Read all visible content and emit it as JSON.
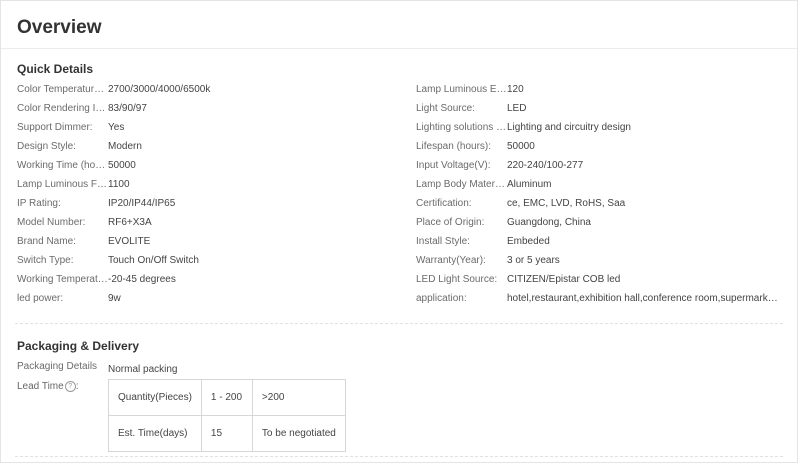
{
  "overview_title": "Overview",
  "quick_details": {
    "heading": "Quick Details",
    "left": [
      {
        "label": "Color Temperature(CCT):",
        "value": "2700/3000/4000/6500k"
      },
      {
        "label": "Color Rendering Index(Ra):",
        "value": "83/90/97"
      },
      {
        "label": "Support Dimmer:",
        "value": "Yes"
      },
      {
        "label": "Design Style:",
        "value": "Modern"
      },
      {
        "label": "Working Time (hours):",
        "value": "50000"
      },
      {
        "label": "Lamp Luminous Flux(lm):",
        "value": "1100"
      },
      {
        "label": "IP Rating:",
        "value": "IP20/IP44/IP65"
      },
      {
        "label": "Model Number:",
        "value": "RF6+X3A"
      },
      {
        "label": "Brand Name:",
        "value": "EVOLITE"
      },
      {
        "label": "Switch Type:",
        "value": "Touch On/Off Switch"
      },
      {
        "label": "Working Temperature:",
        "value": "-20-45 degrees"
      },
      {
        "label": "led power:",
        "value": "9w"
      }
    ],
    "right": [
      {
        "label": "Lamp Luminous Efficiency(lm/w):",
        "value": "120"
      },
      {
        "label": "Light Source:",
        "value": "LED"
      },
      {
        "label": "Lighting solutions service:",
        "value": "Lighting and circuitry design"
      },
      {
        "label": "Lifespan (hours):",
        "value": "50000"
      },
      {
        "label": "Input Voltage(V):",
        "value": "220-240/100-277"
      },
      {
        "label": "Lamp Body Material:",
        "value": "Aluminum"
      },
      {
        "label": "Certification:",
        "value": "ce, EMC, LVD, RoHS, Saa"
      },
      {
        "label": "Place of Origin:",
        "value": "Guangdong, China"
      },
      {
        "label": "Install Style:",
        "value": "Embeded"
      },
      {
        "label": "Warranty(Year):",
        "value": "3 or 5 years"
      },
      {
        "label": "LED Light Source:",
        "value": "CITIZEN/Epistar COB led"
      },
      {
        "label": "application:",
        "value": "hotel,restaurant,exhibition hall,conference room,supermarket ..."
      }
    ]
  },
  "packaging": {
    "heading": "Packaging & Delivery",
    "details_label": "Packaging Details",
    "details_value": "Normal packing",
    "lead_time_label": "Lead Time",
    "help_glyph": "?",
    "lead_table": [
      [
        "Quantity(Pieces)",
        "1 - 200",
        ">200"
      ],
      [
        "Est. Time(days)",
        "15",
        "To be negotiated"
      ]
    ]
  },
  "icons": {
    "help": "help-circle-icon"
  }
}
